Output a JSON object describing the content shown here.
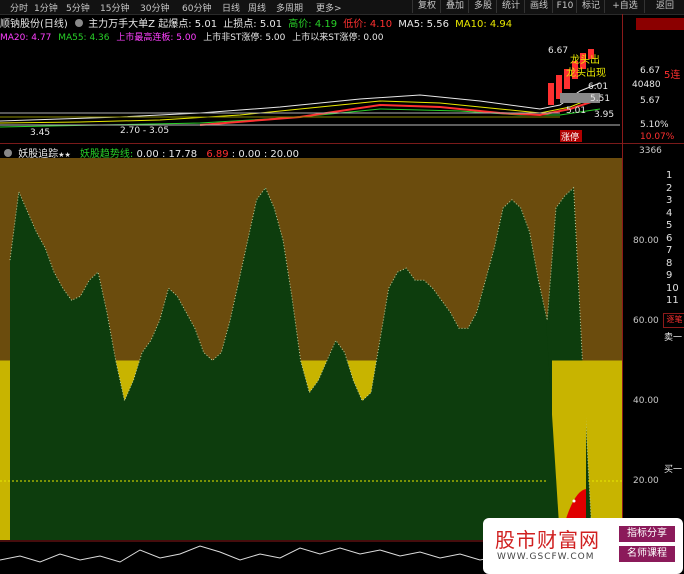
{
  "toolbar": {
    "items": [
      "分时",
      "1分钟",
      "5分钟",
      "15分钟",
      "30分钟",
      "60分钟",
      "日线",
      "周线",
      "多周期",
      "更多>"
    ],
    "buttons": [
      "复权",
      "叠加",
      "多股",
      "统计",
      "画线",
      "F10",
      "标记",
      "+自选",
      "返回"
    ]
  },
  "stock": {
    "name": "顺钠股份",
    "period": "(日线)",
    "formula": "主力万手大单Z",
    "burst_label": "起爆点:",
    "burst_value": "5.01",
    "stop_label": "止损点:",
    "stop_value": "5.01",
    "high_label": "高价:",
    "high_value": "4.19",
    "low_label": "低价:",
    "low_value": "4.10",
    "ma5": "MA5: 5.56",
    "ma10": "MA10: 4.94"
  },
  "info2": {
    "ma20": "MA20: 4.77",
    "ma55": "MA55: 4.36",
    "top_board_label": "上市最高连板:",
    "top_board_value": "5.00",
    "nonst_label": "上市非ST涨停:",
    "nonst_value": "5.00",
    "since_label": "上市以来ST涨停:",
    "since_value": "0.00"
  },
  "main_chart": {
    "annotations": [
      "6.67",
      "龙头出",
      "龙头出现",
      "6.01",
      "5.51",
      "5.01",
      "3.95"
    ],
    "left_labels": [
      "3.45",
      "2.70 - 3.05"
    ],
    "axis_labels": [
      "6.67",
      "40480",
      "5.67"
    ],
    "pct_labels": [
      "5.10%",
      "10.07%"
    ],
    "zt_label": "涨停",
    "limit_up_badge": "5连"
  },
  "indicator": {
    "title": "妖股追踪",
    "stars": "★★",
    "line_label": "妖股趋势线:",
    "v1": "0.00",
    "v2": "17.78",
    "v3": "6.89",
    "v4": "0.00",
    "v5": "20.00",
    "top_right_value": "3366",
    "y_ticks": [
      "80.00",
      "60.00",
      "40.00",
      "20.00"
    ],
    "rank_numbers": [
      "1",
      "2",
      "3",
      "4",
      "5",
      "6",
      "7",
      "8",
      "9",
      "10",
      "11"
    ],
    "side_labels": [
      "逐笔",
      "卖一",
      "买一"
    ]
  },
  "chart_data": {
    "type": "area",
    "title": "妖股追踪",
    "ylim": [
      0,
      95
    ],
    "series": [
      {
        "name": "妖股趋势线",
        "values": [
          75,
          92,
          87,
          82,
          78,
          72,
          68,
          65,
          66,
          70,
          72,
          62,
          50,
          40,
          45,
          52,
          55,
          60,
          68,
          66,
          62,
          58,
          52,
          50,
          52,
          60,
          70,
          80,
          90,
          93,
          88,
          80,
          66,
          50,
          42,
          45,
          50,
          55,
          52,
          45,
          40,
          42,
          55,
          68,
          72,
          73,
          70,
          70,
          68,
          65,
          62,
          58,
          58,
          62,
          70,
          78,
          88,
          90,
          88,
          82,
          70,
          60,
          88,
          91,
          93,
          50,
          10,
          6
        ]
      }
    ],
    "thresholds": [
      50,
      20
    ],
    "colors": {
      "area": "#0d3d0d",
      "bg": "#6b4c0d",
      "zone": "#c8b400",
      "red": "#e00000"
    }
  },
  "watermark": {
    "main": "股市财富网",
    "url": "WWW.GSCFW.COM",
    "tag1": "指标分享",
    "tag2": "名师课程"
  }
}
